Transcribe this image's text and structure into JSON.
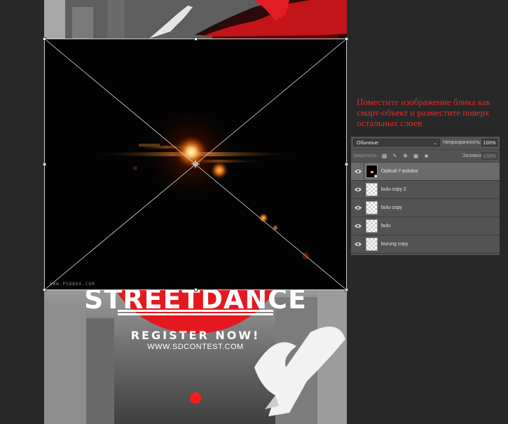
{
  "canvas": {
    "poster": {
      "title": "STREETDANCE",
      "cta": "REGISTER NOW!",
      "url": "WWW.SDCONTEST.COM"
    },
    "placed_image": {
      "watermark": "WWW.PSDBOX.COM"
    }
  },
  "annotation": {
    "text": "Поместите изображение блика как смарт-объект и разместите поверх остальных слоев"
  },
  "layers_panel": {
    "blend_mode": "Обычные",
    "opacity_label": "Непрозрачность:",
    "opacity_value": "100%",
    "lock_label": "Закрепить:",
    "fill_label": "Заливка:",
    "fill_value": "100%",
    "layers": [
      {
        "name": "Optical-7-psbdox",
        "selected": true,
        "smart_object": true
      },
      {
        "name": "bulu copy 2",
        "selected": false
      },
      {
        "name": "bulu copy",
        "selected": false
      },
      {
        "name": "bulu",
        "selected": false
      },
      {
        "name": "burung copy",
        "selected": false
      }
    ]
  },
  "colors": {
    "workspace": "#282828",
    "panel": "#535353",
    "selected_layer": "#6b6b6b",
    "annotation": "#e02a2a",
    "poster_red": "#e4191f",
    "flare_core": "#ffb040"
  }
}
